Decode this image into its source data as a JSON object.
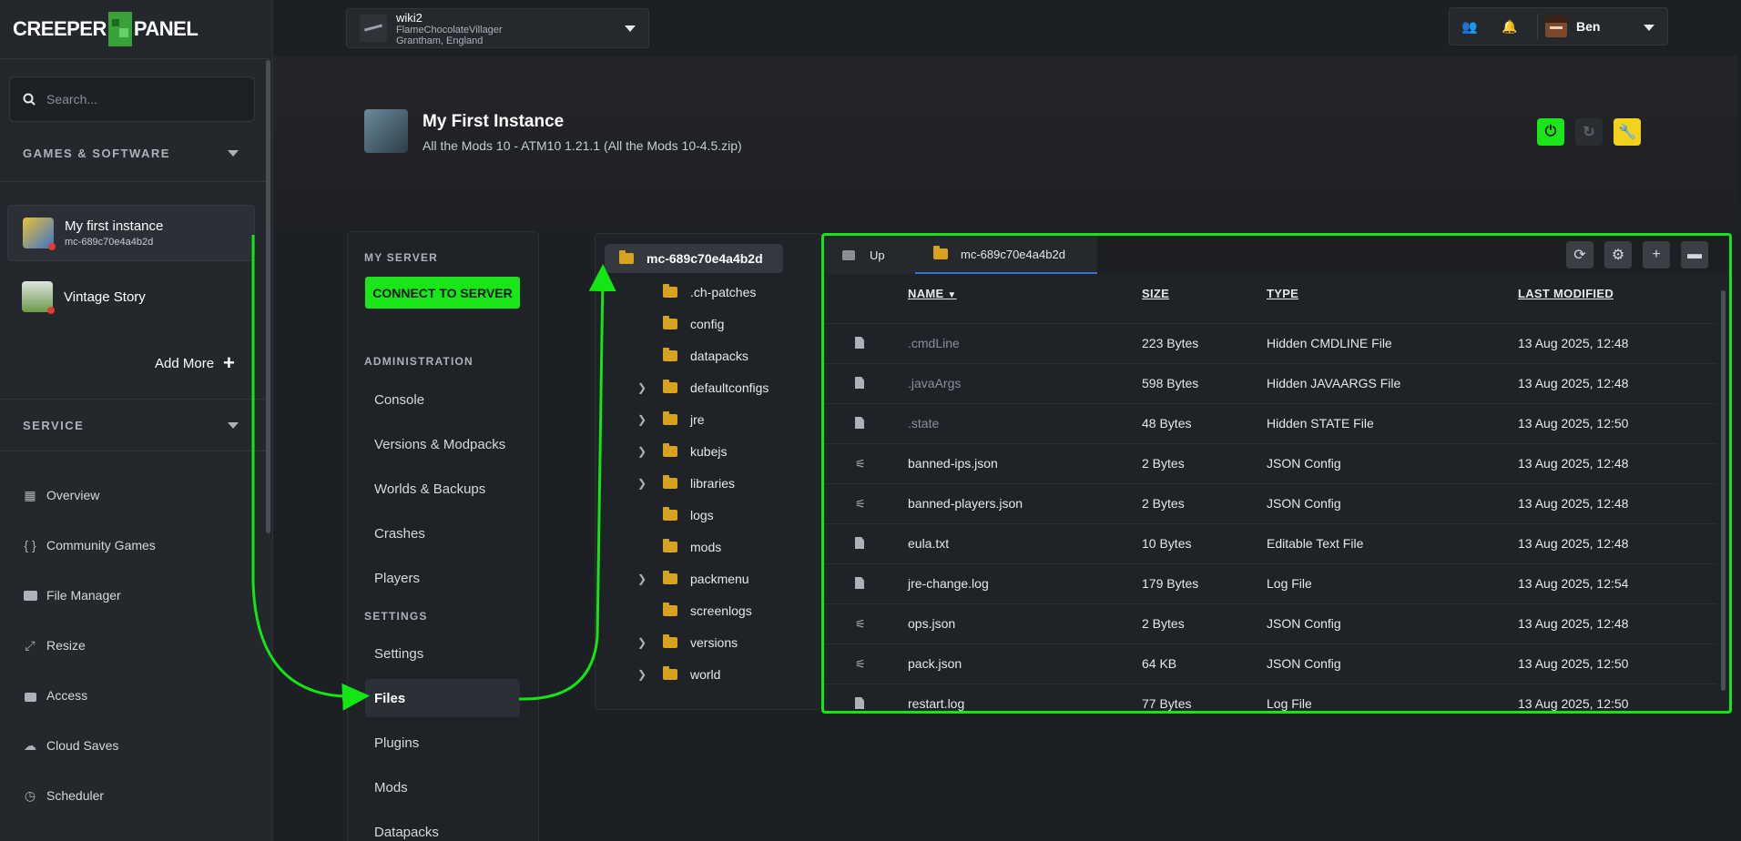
{
  "logo": {
    "left": "CREEPER",
    "right": "PANEL"
  },
  "search": {
    "placeholder": "Search..."
  },
  "sidebar": {
    "games_heading": "GAMES & SOFTWARE",
    "instances": [
      {
        "name": "My first instance",
        "sub": "mc-689c70e4a4b2d"
      },
      {
        "name": "Vintage Story",
        "sub": ""
      }
    ],
    "add_more": "Add More",
    "service_heading": "SERVICE",
    "nav": [
      {
        "label": "Overview",
        "icon": "grid-icon"
      },
      {
        "label": "Community Games",
        "icon": "braces-icon"
      },
      {
        "label": "File Manager",
        "icon": "folder-icon"
      },
      {
        "label": "Resize",
        "icon": "resize-icon"
      },
      {
        "label": "Access",
        "icon": "lock-icon"
      },
      {
        "label": "Cloud Saves",
        "icon": "cloud-icon"
      },
      {
        "label": "Scheduler",
        "icon": "clock-icon"
      }
    ]
  },
  "server_select": {
    "title": "wiki2",
    "line1": "FlameChocolateVillager",
    "line2": "Grantham, England"
  },
  "user": {
    "name": "Ben"
  },
  "instance": {
    "title": "My First Instance",
    "subtitle": "All the Mods 10 - ATM10 1.21.1 (All the Mods 10-4.5.zip)"
  },
  "menu": {
    "my_server": "MY SERVER",
    "connect": "CONNECT TO SERVER",
    "administration": "ADMINISTRATION",
    "admin_items": [
      "Console",
      "Versions & Modpacks",
      "Worlds & Backups",
      "Crashes",
      "Players"
    ],
    "settings_heading": "SETTINGS",
    "settings_items": [
      "Settings",
      "Files",
      "Plugins",
      "Mods",
      "Datapacks"
    ]
  },
  "tree": {
    "root": "mc-689c70e4a4b2d",
    "items": [
      {
        "name": ".ch-patches",
        "expandable": false
      },
      {
        "name": "config",
        "expandable": false
      },
      {
        "name": "datapacks",
        "expandable": false
      },
      {
        "name": "defaultconfigs",
        "expandable": true
      },
      {
        "name": "jre",
        "expandable": true
      },
      {
        "name": "kubejs",
        "expandable": true
      },
      {
        "name": "libraries",
        "expandable": true
      },
      {
        "name": "logs",
        "expandable": false
      },
      {
        "name": "mods",
        "expandable": false
      },
      {
        "name": "packmenu",
        "expandable": true
      },
      {
        "name": "screenlogs",
        "expandable": false
      },
      {
        "name": "versions",
        "expandable": true
      },
      {
        "name": "world",
        "expandable": true
      }
    ]
  },
  "files": {
    "tabs": {
      "up": "Up",
      "current": "mc-689c70e4a4b2d"
    },
    "headers": {
      "name": "NAME",
      "size": "SIZE",
      "type": "TYPE",
      "modified": "LAST MODIFIED"
    },
    "rows": [
      {
        "name": ".cmdLine",
        "size": "223 Bytes",
        "type": "Hidden CMDLINE File",
        "modified": "13 Aug 2025, 12:48",
        "icon": "doc",
        "hidden": true
      },
      {
        "name": ".javaArgs",
        "size": "598 Bytes",
        "type": "Hidden JAVAARGS File",
        "modified": "13 Aug 2025, 12:48",
        "icon": "doc",
        "hidden": true
      },
      {
        "name": ".state",
        "size": "48 Bytes",
        "type": "Hidden STATE File",
        "modified": "13 Aug 2025, 12:50",
        "icon": "doc",
        "hidden": true
      },
      {
        "name": "banned-ips.json",
        "size": "2 Bytes",
        "type": "JSON Config",
        "modified": "13 Aug 2025, 12:48",
        "icon": "config",
        "hidden": false
      },
      {
        "name": "banned-players.json",
        "size": "2 Bytes",
        "type": "JSON Config",
        "modified": "13 Aug 2025, 12:48",
        "icon": "config",
        "hidden": false
      },
      {
        "name": "eula.txt",
        "size": "10 Bytes",
        "type": "Editable Text File",
        "modified": "13 Aug 2025, 12:48",
        "icon": "text",
        "hidden": false
      },
      {
        "name": "jre-change.log",
        "size": "179 Bytes",
        "type": "Log File",
        "modified": "13 Aug 2025, 12:54",
        "icon": "text",
        "hidden": false
      },
      {
        "name": "ops.json",
        "size": "2 Bytes",
        "type": "JSON Config",
        "modified": "13 Aug 2025, 12:48",
        "icon": "config",
        "hidden": false
      },
      {
        "name": "pack.json",
        "size": "64 KB",
        "type": "JSON Config",
        "modified": "13 Aug 2025, 12:50",
        "icon": "config",
        "hidden": false
      },
      {
        "name": "restart.log",
        "size": "77 Bytes",
        "type": "Log File",
        "modified": "13 Aug 2025, 12:50",
        "icon": "text",
        "hidden": false
      }
    ]
  },
  "colors": {
    "accent_green": "#14e614",
    "power": "#19e619",
    "wrench": "#f2d21a",
    "folder": "#d8a21f",
    "tab_underline": "#3b6fd8"
  }
}
